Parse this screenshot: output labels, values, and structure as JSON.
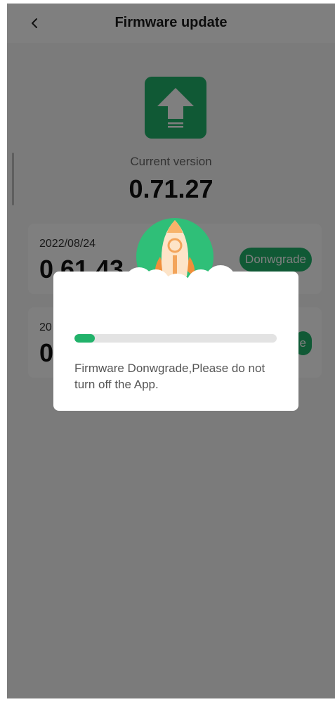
{
  "header": {
    "title": "Firmware update",
    "back_icon": "chevron-left-icon"
  },
  "current": {
    "icon": "upload-arrow-icon",
    "label": "Current version",
    "value": "0.71.27"
  },
  "versions": [
    {
      "date": "2022/08/24",
      "version": "0.61.43",
      "button_label": "Donwgrade"
    },
    {
      "date": "20",
      "version": "0",
      "button_label": "e"
    }
  ],
  "dialog": {
    "illustration": "rocket-icon",
    "progress_fraction": 0.1,
    "message": "Firmware Donwgrade,Please do not turn off the App."
  },
  "colors": {
    "accent": "#21b26a",
    "overlay": "rgba(0,0,0,0.5)",
    "track": "#e3e3e3"
  }
}
